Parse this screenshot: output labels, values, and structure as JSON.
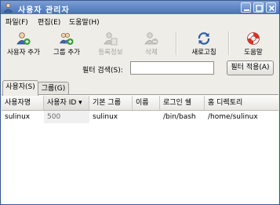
{
  "window": {
    "title": "사용자 관리자"
  },
  "menubar": [
    {
      "label": "파일(F)"
    },
    {
      "label": "편집(E)"
    },
    {
      "label": "도움말(H)"
    }
  ],
  "toolbar": {
    "add_user": "사용자 추가",
    "add_group": "그룹 추가",
    "properties": "등록정보",
    "delete": "삭제",
    "refresh": "새로고침",
    "help": "도움말"
  },
  "filter": {
    "label": "필터 검색(S):",
    "value": "",
    "apply_label": "필터 적용(A)"
  },
  "tabs": [
    {
      "label": "사용자(S)",
      "active": true
    },
    {
      "label": "그룹(G)",
      "active": false
    }
  ],
  "table": {
    "columns": [
      "사용자명",
      "사용자 ID ▾",
      "기본 그룹",
      "이름",
      "로그인 쉘",
      "홈 디렉토리"
    ],
    "rows": [
      [
        "sulinux",
        "500",
        "sulinux",
        "",
        "/bin/bash",
        "/home/sulinux"
      ]
    ]
  },
  "colors": {
    "titlebar": "#5b80c0",
    "accent_green": "#2e9a2e",
    "disabled": "#a5a5a0"
  }
}
